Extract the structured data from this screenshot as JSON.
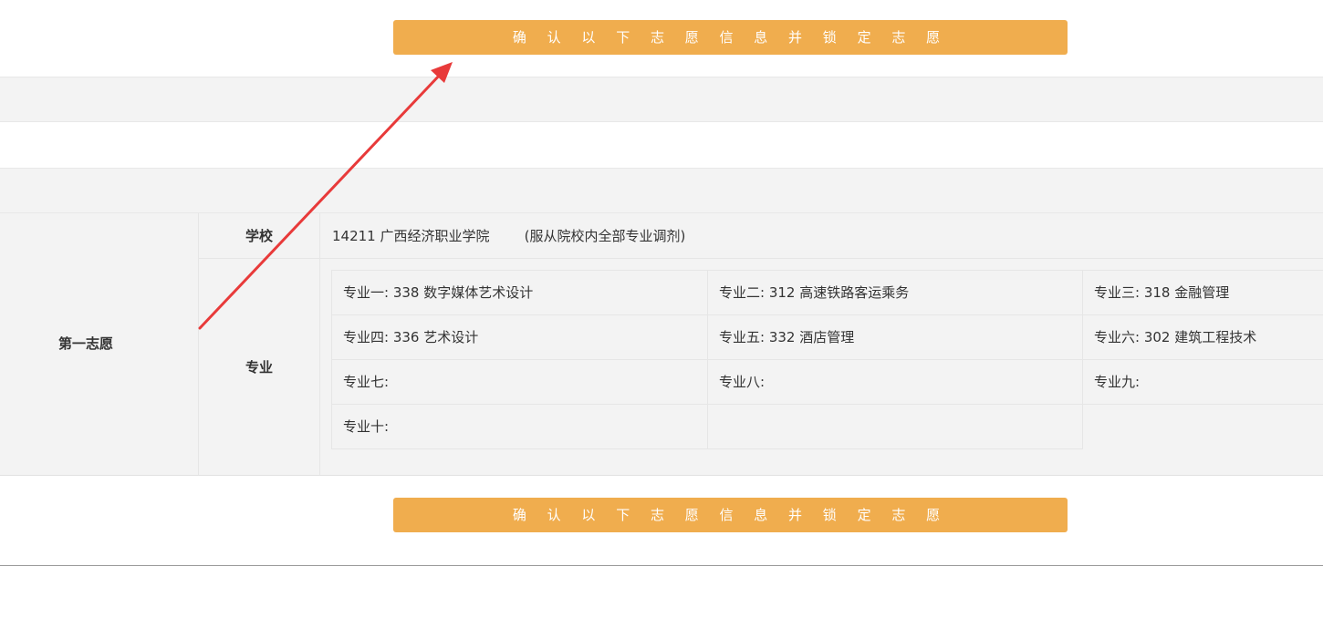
{
  "colors": {
    "accent": "#f0ad4e",
    "annotation": "#e83a3a"
  },
  "buttons": {
    "confirm_top": "确 认 以 下 志 愿 信 息 并 锁 定 志 愿",
    "confirm_bottom": "确 认 以 下 志 愿 信 息 并 锁 定 志 愿"
  },
  "choice": {
    "title": "第一志愿",
    "school_label": "学校",
    "school_value": "14211 广西经济职业学院        (服从院校内全部专业调剂)",
    "major_label": "专业",
    "majors": [
      "专业一: 338 数字媒体艺术设计",
      "专业二: 312 高速铁路客运乘务",
      "专业三: 318 金融管理",
      "专业四: 336 艺术设计",
      "专业五: 332 酒店管理",
      "专业六: 302 建筑工程技术",
      "专业七:",
      "专业八:",
      "专业九:",
      "专业十:"
    ]
  }
}
